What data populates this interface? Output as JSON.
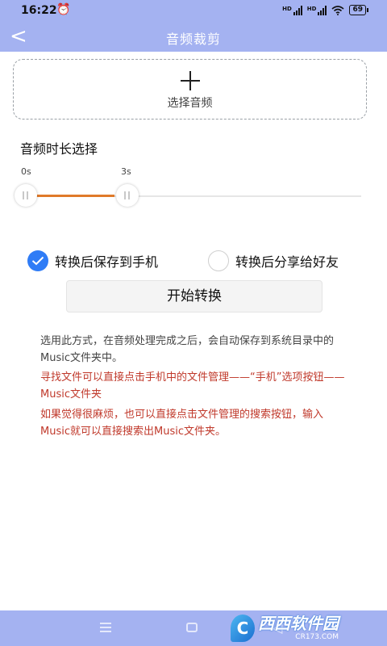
{
  "status_bar": {
    "time": "16:22",
    "alarm_icon": "alarm-clock-icon",
    "signal1_label": "HD",
    "signal2_label": "HD",
    "wifi_icon": "wifi-icon",
    "battery": "69"
  },
  "header": {
    "back_icon": "chevron-left-icon",
    "back_glyph": "<",
    "title": "音频裁剪"
  },
  "upload": {
    "icon": "plus-icon",
    "label": "选择音频"
  },
  "duration": {
    "title": "音频时长选择",
    "start_label": "0s",
    "end_label": "3s",
    "range_start_s": 0,
    "range_end_s": 3
  },
  "options": {
    "save_to_phone": {
      "label": "转换后保存到手机",
      "checked": true
    },
    "share_to_friend": {
      "label": "转换后分享给好友",
      "checked": false
    }
  },
  "start_button": {
    "label": "开始转换"
  },
  "notes": {
    "line1": "选用此方式，在音频处理完成之后，会自动保存到系统目录中的Music文件夹中。",
    "line2": "寻找文件可以直接点击手机中的文件管理——“手机”选项按钮——Music文件夹",
    "line3": "如果觉得很麻烦，也可以直接点击文件管理的搜索按钮，输入Music就可以直接搜索出Music文件夹。"
  },
  "nav_bar": {
    "menu_icon": "menu-icon",
    "home_icon": "home-square-icon",
    "back_icon": "back-triangle-icon",
    "back_glyph": "◁"
  },
  "watermark": {
    "logo_glyph": "C",
    "brand": "西西软件园",
    "domain": "CR173.COM"
  },
  "colors": {
    "accent": "#a4b2f1",
    "progress": "#e07a2a",
    "check": "#2f7cf6",
    "warning_text": "#c0392b"
  }
}
